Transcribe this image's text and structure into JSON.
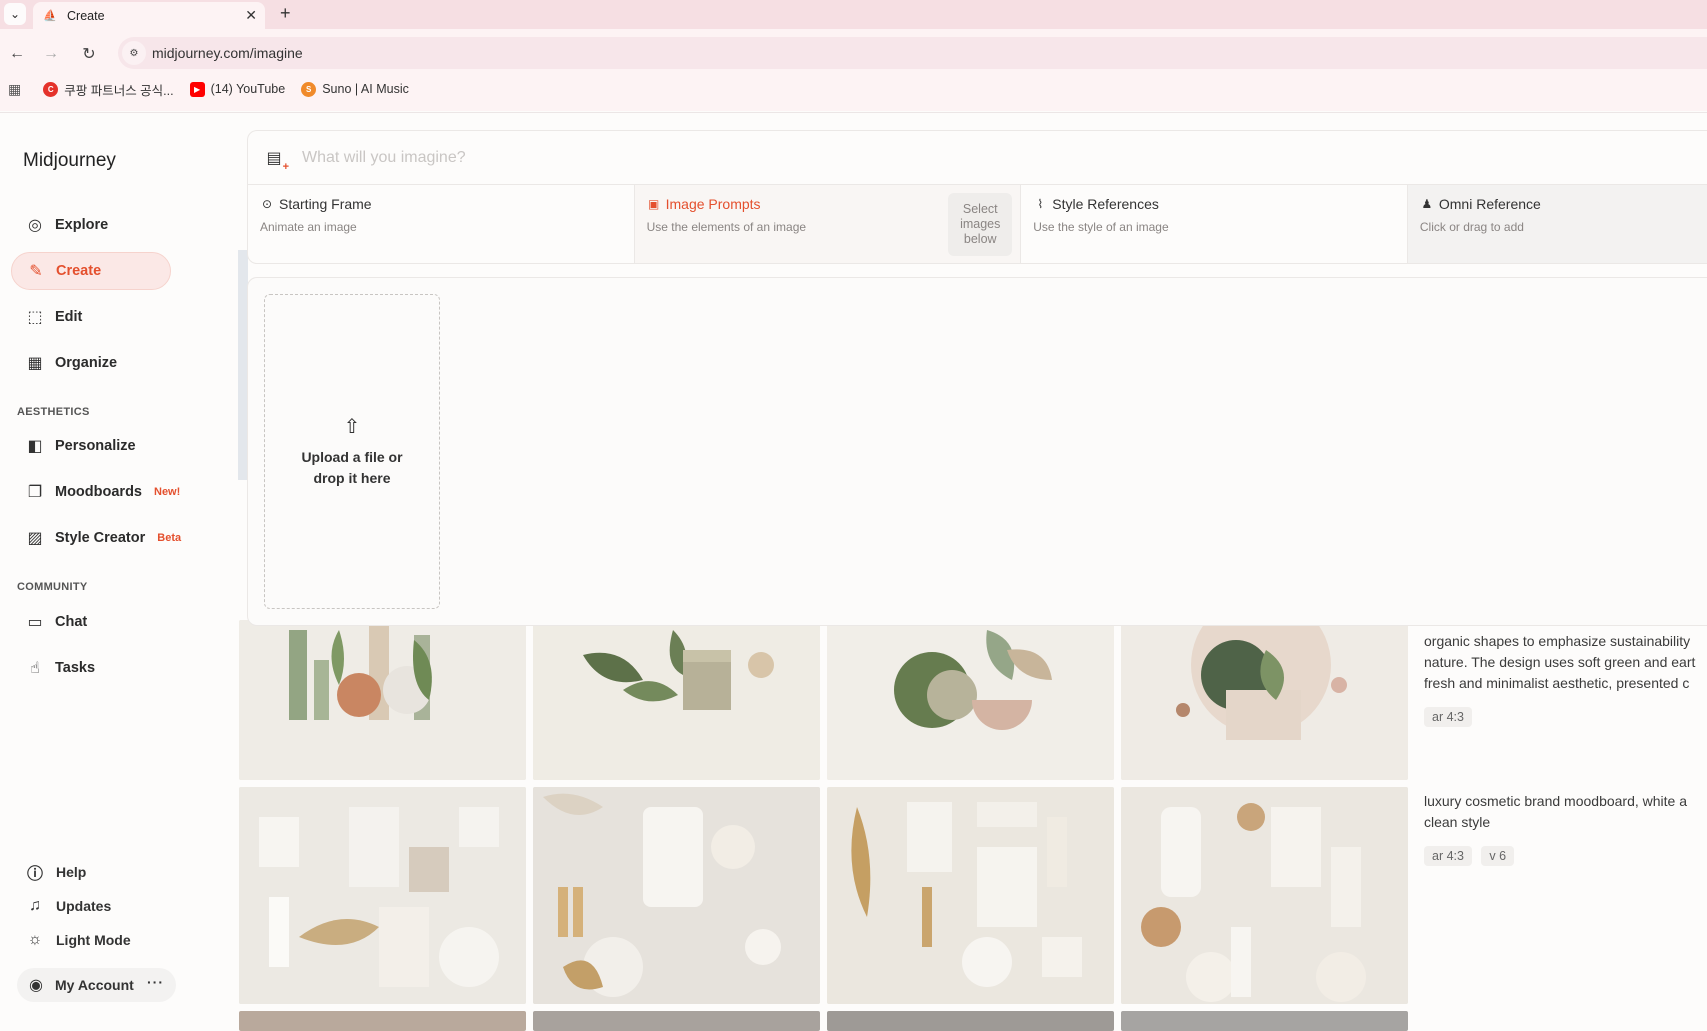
{
  "browser": {
    "tab_title": "Create",
    "new_tab": "+",
    "tab_close": "✕",
    "url": "midjourney.com/imagine",
    "bookmarks": [
      {
        "label": "쿠팡 파트너스 공식...",
        "icon": "coupang-icon",
        "color": "#e4322b",
        "glyph": "C"
      },
      {
        "label": "(14) YouTube",
        "icon": "youtube-icon",
        "color": "#ff0000",
        "glyph": "▶"
      },
      {
        "label": "Suno | AI Music",
        "icon": "suno-icon",
        "color": "#f08a2a",
        "glyph": "S"
      }
    ]
  },
  "sidebar": {
    "brand": "Midjourney",
    "nav": [
      {
        "label": "Explore",
        "icon": "compass-icon",
        "glyph": "◎"
      },
      {
        "label": "Create",
        "icon": "brush-icon",
        "glyph": "✎",
        "active": true
      },
      {
        "label": "Edit",
        "icon": "edit-frame-icon",
        "glyph": "⬚"
      },
      {
        "label": "Organize",
        "icon": "grid-icon",
        "glyph": "▦"
      }
    ],
    "aesthetics_label": "AESTHETICS",
    "aesthetics": [
      {
        "label": "Personalize",
        "icon": "personalize-icon",
        "glyph": "◧"
      },
      {
        "label": "Moodboards",
        "icon": "moodboard-icon",
        "glyph": "❐",
        "badge": "New!"
      },
      {
        "label": "Style Creator",
        "icon": "style-creator-icon",
        "glyph": "▨",
        "badge": "Beta"
      }
    ],
    "community_label": "COMMUNITY",
    "community": [
      {
        "label": "Chat",
        "icon": "chat-icon",
        "glyph": "💬"
      },
      {
        "label": "Tasks",
        "icon": "thumbs-up-icon",
        "glyph": "👍"
      }
    ],
    "footer": [
      {
        "label": "Help",
        "icon": "help-icon",
        "glyph": "?"
      },
      {
        "label": "Updates",
        "icon": "bell-icon",
        "glyph": "🔔"
      },
      {
        "label": "Light Mode",
        "icon": "sun-icon",
        "glyph": "☼"
      }
    ],
    "account_label": "My Account",
    "account_more": "···"
  },
  "prompt": {
    "placeholder": "What will you imagine?"
  },
  "references": [
    {
      "title": "Starting Frame",
      "subtitle": "Animate an image",
      "icon": "play-circle-icon"
    },
    {
      "title": "Image Prompts",
      "subtitle": "Use the elements of an image",
      "icon": "image-icon",
      "active": true,
      "helper": "Select images below"
    },
    {
      "title": "Style References",
      "subtitle": "Use the style of an image",
      "icon": "paperclip-icon"
    },
    {
      "title": "Omni Reference",
      "subtitle": "Click or drag to add",
      "icon": "person-icon"
    }
  ],
  "dropzone": {
    "label": "Upload a file or drop it here",
    "icon": "upload-icon"
  },
  "gallery": {
    "rows": [
      {
        "description_lines": [
          "organic shapes to emphasize sustainability",
          "nature. The design uses soft green and eart",
          "fresh and minimalist aesthetic, presented c"
        ],
        "chips": [
          "ar 4:3"
        ]
      },
      {
        "description_lines": [
          "luxury cosmetic brand moodboard, white a",
          "clean style"
        ],
        "chips": [
          "ar 4:3",
          "v 6"
        ]
      }
    ]
  },
  "colors": {
    "accent": "#e4502e",
    "tabbar": "#f6dfe3",
    "toolbar": "#fdf3f4"
  }
}
